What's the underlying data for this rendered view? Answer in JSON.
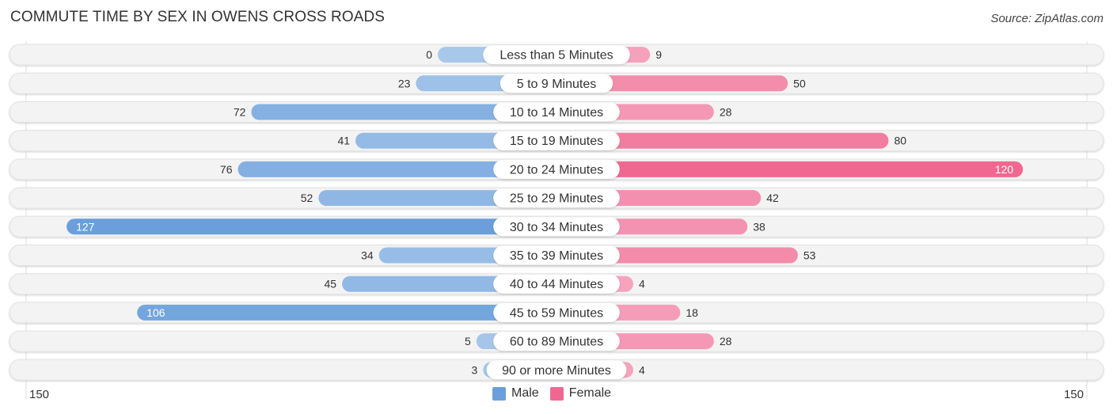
{
  "title": "COMMUTE TIME BY SEX IN OWENS CROSS ROADS",
  "source": "Source: ZipAtlas.com",
  "colors": {
    "male": "#6a9fdc",
    "male_light": "#a8c8ea",
    "female": "#f06892",
    "female_light": "#f6a6bf"
  },
  "legend": {
    "male": "Male",
    "female": "Female"
  },
  "axis": {
    "left_label": "150",
    "right_label": "150"
  },
  "chart_data": {
    "type": "bar",
    "orientation": "horizontal-diverging",
    "title": "COMMUTE TIME BY SEX IN OWENS CROSS ROADS",
    "categories": [
      "Less than 5 Minutes",
      "5 to 9 Minutes",
      "10 to 14 Minutes",
      "15 to 19 Minutes",
      "20 to 24 Minutes",
      "25 to 29 Minutes",
      "30 to 34 Minutes",
      "35 to 39 Minutes",
      "40 to 44 Minutes",
      "45 to 59 Minutes",
      "60 to 89 Minutes",
      "90 or more Minutes"
    ],
    "series": [
      {
        "name": "Male",
        "values": [
          0,
          23,
          72,
          41,
          76,
          52,
          127,
          34,
          45,
          106,
          5,
          3
        ]
      },
      {
        "name": "Female",
        "values": [
          9,
          50,
          28,
          80,
          120,
          42,
          38,
          53,
          4,
          18,
          28,
          4
        ]
      }
    ],
    "xlim": [
      150,
      150
    ],
    "legend_position": "bottom-center"
  }
}
